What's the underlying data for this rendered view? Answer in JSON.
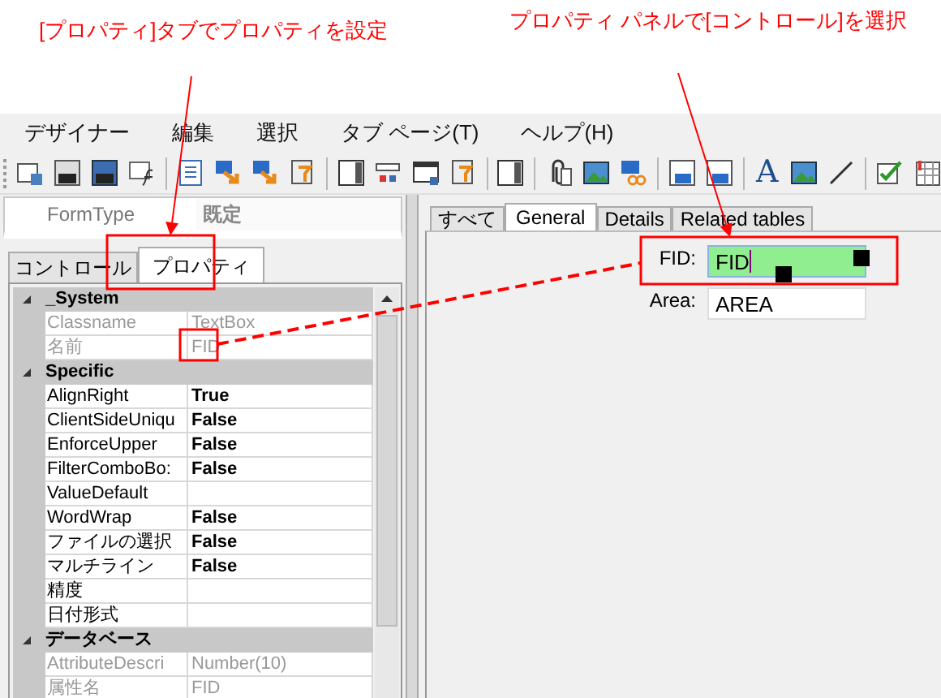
{
  "annotations": [
    {
      "text": "[プロパティ]タブでプロパティを設定"
    },
    {
      "text": "プロパティ パネルで[コントロール]を選択"
    }
  ],
  "menu": [
    {
      "label": "デザイナー"
    },
    {
      "label": "編集"
    },
    {
      "label": "選択"
    },
    {
      "label": "タブ ページ(T)"
    },
    {
      "label": "ヘルプ(H)"
    }
  ],
  "toolbar": {
    "text_tool_glyph": "A"
  },
  "form_type": {
    "label": "FormType",
    "value": "既定"
  },
  "left_tabs": [
    {
      "label": "コントロール",
      "selected": false
    },
    {
      "label": "プロパティ",
      "selected": true
    }
  ],
  "properties": [
    {
      "category": "_System",
      "expanded": true,
      "rows": [
        {
          "name": "Classname",
          "value": "TextBox",
          "readonly": true
        },
        {
          "name": "名前",
          "value": "FID",
          "readonly": true
        }
      ]
    },
    {
      "category": "Specific",
      "expanded": true,
      "rows": [
        {
          "name": "AlignRight",
          "value": "True",
          "readonly": false
        },
        {
          "name": "ClientSideUniqu",
          "value": "False",
          "readonly": false
        },
        {
          "name": "EnforceUpper",
          "value": "False",
          "readonly": false
        },
        {
          "name": "FilterComboBo:",
          "value": "False",
          "readonly": false
        },
        {
          "name": "ValueDefault",
          "readonly": false
        },
        {
          "name": "WordWrap",
          "value": "False",
          "readonly": false
        },
        {
          "name": "ファイルの選択",
          "value": "False",
          "readonly": false
        },
        {
          "name": "マルチライン",
          "value": "False",
          "readonly": false
        },
        {
          "name": "精度",
          "readonly": false
        },
        {
          "name": "日付形式",
          "readonly": false
        }
      ]
    },
    {
      "category": "データベース",
      "expanded": true,
      "rows": [
        {
          "name": "AttributeDescri",
          "value": "Number(10)",
          "readonly": true
        },
        {
          "name": "属性名",
          "value": "FID",
          "readonly": true
        }
      ]
    }
  ],
  "designer_tabs": [
    {
      "label": "すべて",
      "selected": false
    },
    {
      "label": "General",
      "selected": true
    },
    {
      "label": "Details",
      "selected": false
    },
    {
      "label": "Related tables",
      "selected": false
    }
  ],
  "fields": [
    {
      "label": "FID:",
      "value": "FID",
      "selected": true
    },
    {
      "label": "Area:",
      "value": "AREA",
      "selected": false
    }
  ]
}
